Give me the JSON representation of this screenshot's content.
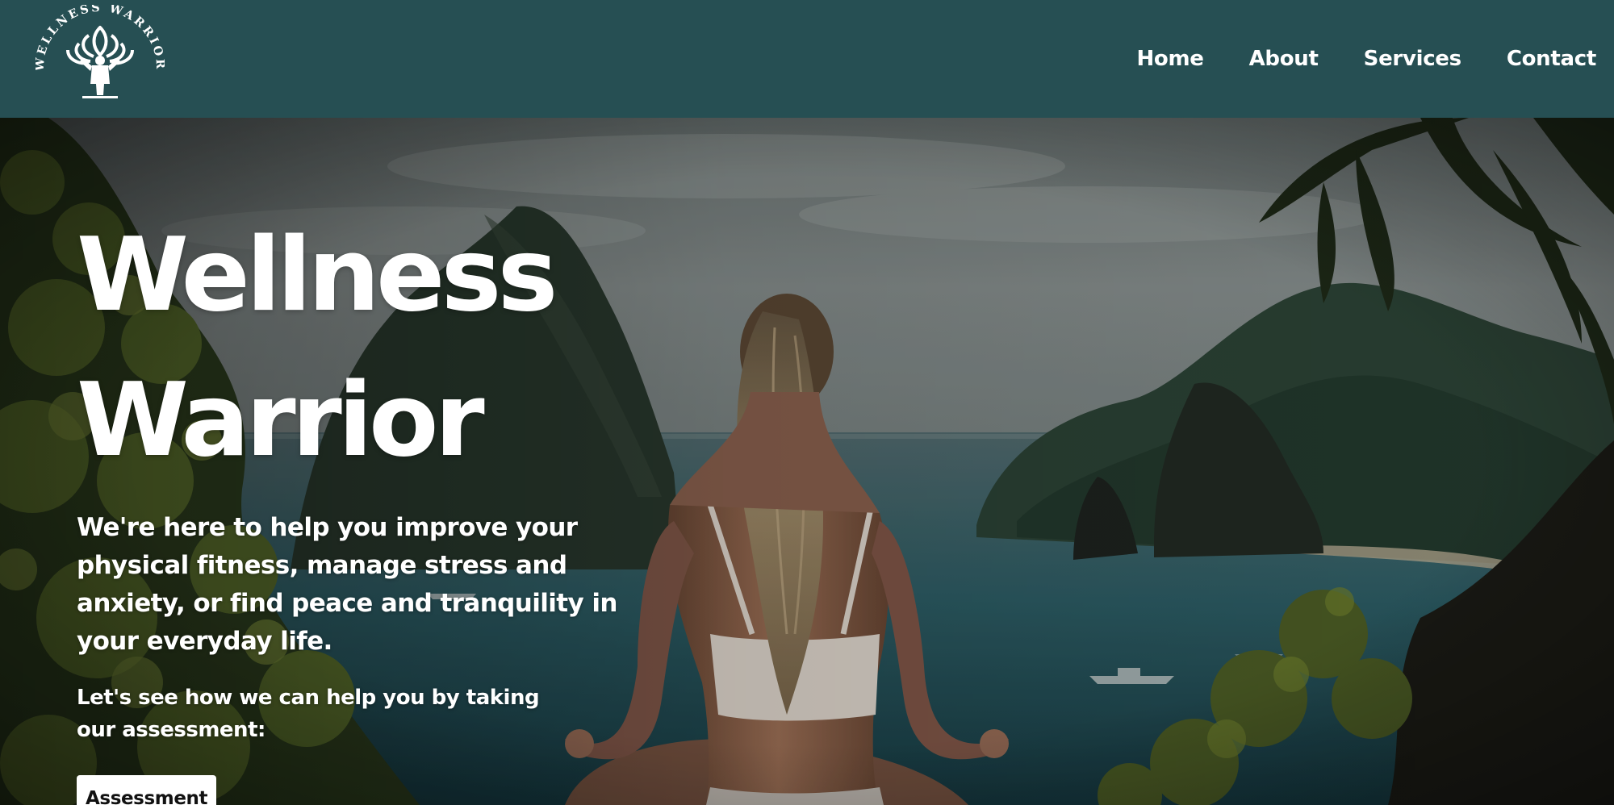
{
  "logo": {
    "text": "WELLNESS WARRIOR",
    "icon": "lotus-person-icon"
  },
  "nav": {
    "items": [
      {
        "label": "Home"
      },
      {
        "label": "About"
      },
      {
        "label": "Services"
      },
      {
        "label": "Contact"
      }
    ]
  },
  "hero": {
    "title_line1": "Wellness",
    "title_line2": "Warrior",
    "description": "We're here to help you improve your physical fitness, manage stress and anxiety, or find peace and tranquility in your everyday life.",
    "cta_text": "Let's see how we can help you by taking our assessment:",
    "button_label": "Assessment",
    "background": "woman-meditating-overlooking-tropical-bay-photo"
  },
  "colors": {
    "header_bg": "#264f53",
    "text": "#ffffff",
    "button_bg": "#ffffff",
    "button_text": "#111111"
  }
}
